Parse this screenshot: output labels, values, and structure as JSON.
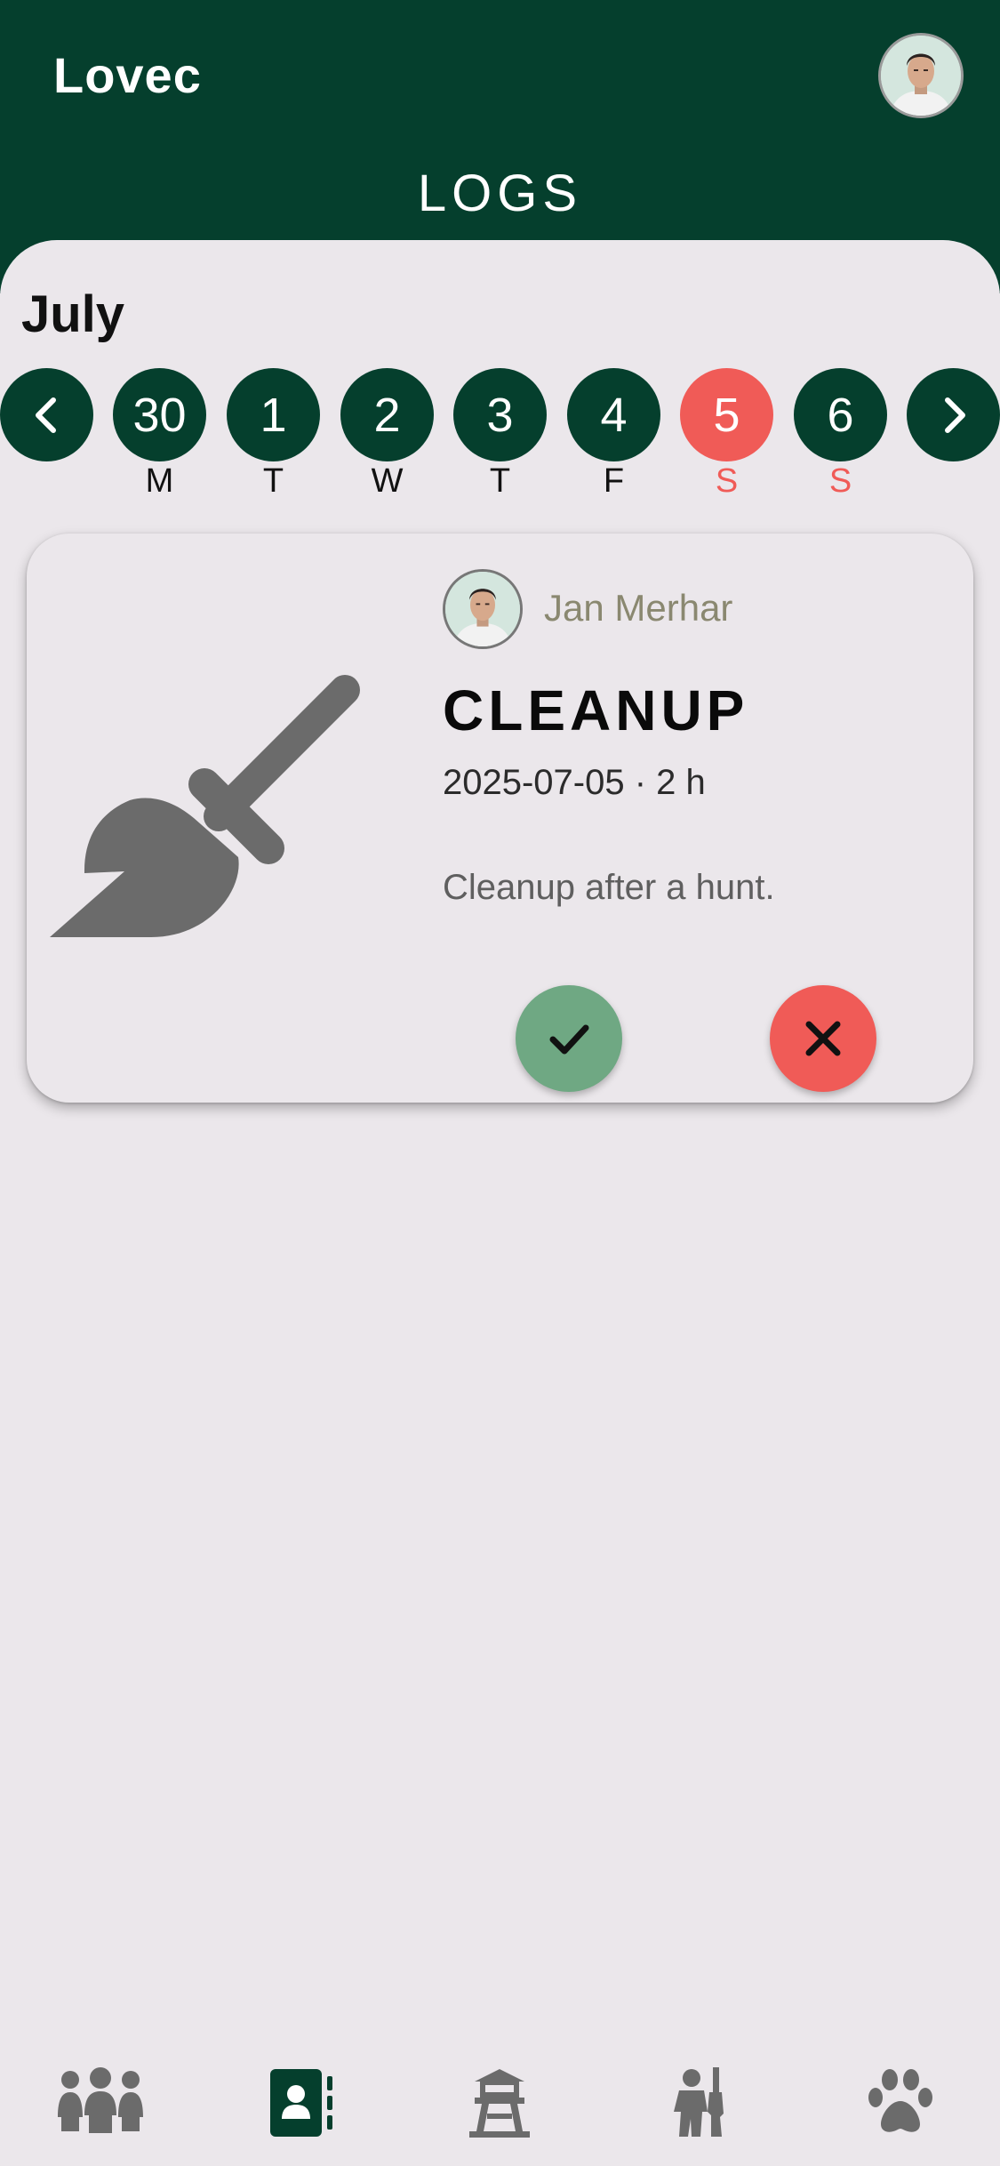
{
  "header": {
    "app_title": "Lovec",
    "page_title": "LOGS",
    "avatar_icon": "user-avatar"
  },
  "calendar": {
    "month": "July",
    "prev_icon": "chevron-left-icon",
    "next_icon": "chevron-right-icon",
    "days": [
      {
        "number": "30",
        "weekday": "M",
        "selected": false,
        "weekend": false
      },
      {
        "number": "1",
        "weekday": "T",
        "selected": false,
        "weekend": false
      },
      {
        "number": "2",
        "weekday": "W",
        "selected": false,
        "weekend": false
      },
      {
        "number": "3",
        "weekday": "T",
        "selected": false,
        "weekend": false
      },
      {
        "number": "4",
        "weekday": "F",
        "selected": false,
        "weekend": false
      },
      {
        "number": "5",
        "weekday": "S",
        "selected": true,
        "weekend": true
      },
      {
        "number": "6",
        "weekday": "S",
        "selected": false,
        "weekend": true
      }
    ]
  },
  "log_card": {
    "icon": "broom-icon",
    "author": "Jan Merhar",
    "type": "CLEANUP",
    "meta": "2025-07-05 · 2 h",
    "description": "Cleanup after a hunt.",
    "approve_icon": "check-icon",
    "reject_icon": "close-icon"
  },
  "bottom_nav": [
    {
      "icon": "people-group-icon",
      "active": false
    },
    {
      "icon": "contact-book-icon",
      "active": true
    },
    {
      "icon": "watchtower-icon",
      "active": false
    },
    {
      "icon": "hunter-icon",
      "active": false
    },
    {
      "icon": "paw-icon",
      "active": false
    }
  ],
  "colors": {
    "primary": "#053f2d",
    "accent": "#f05b57",
    "approve": "#6fa883",
    "background": "#ebe7eb",
    "icon_gray": "#6b6b6b"
  }
}
